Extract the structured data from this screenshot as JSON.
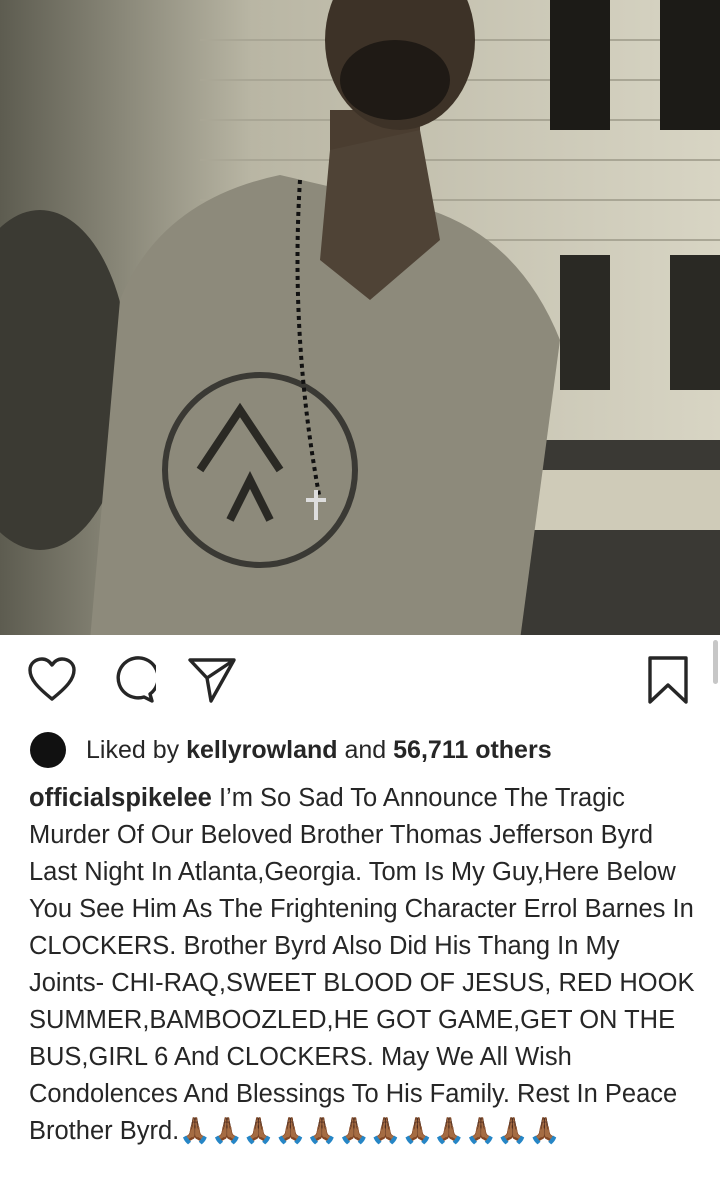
{
  "post": {
    "photo_alt_icon": "photo",
    "actions": {
      "like_icon": "heart-icon",
      "comment_icon": "comment-icon",
      "share_icon": "paper-plane-icon",
      "save_icon": "bookmark-icon"
    },
    "likes": {
      "prefix": "Liked by",
      "user": "kellyrowland",
      "middle": "and",
      "count": "56,711 others"
    },
    "caption": {
      "username": "officialspikelee",
      "text": "I’m So Sad To Announce The Tragic Murder Of Our Beloved Brother Thomas Jefferson Byrd Last Night In Atlanta,Georgia. Tom Is My Guy,Here Below You See Him As The Frightening Character Errol Barnes In CLOCKERS. Brother Byrd Also Did His Thang In My Joints- CHI-RAQ,SWEET BLOOD OF JESUS, RED HOOK SUMMER,BAMBOOZLED,HE GOT GAME,GET ON THE BUS,GIRL 6 And CLOCKERS. May We All Wish Condolences And Blessings To His Family. Rest In Peace Brother Byrd.",
      "emoji": "🙏🏾🙏🏾🙏🏾🙏🏾🙏🏾🙏🏾🙏🏾🙏🏾🙏🏾🙏🏾🙏🏾🙏🏾"
    }
  },
  "colors": {
    "text": "#262626",
    "background": "#ffffff"
  }
}
